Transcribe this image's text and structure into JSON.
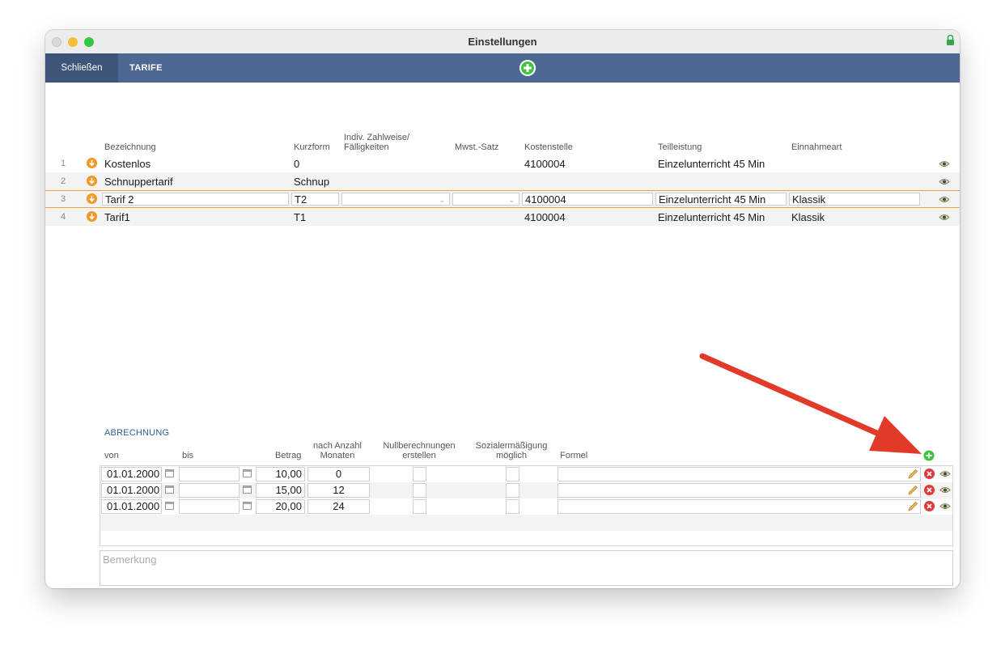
{
  "window": {
    "title": "Einstellungen"
  },
  "toolbar": {
    "close_label": "Schließen",
    "tab_label": "TARIFE"
  },
  "table": {
    "headers": {
      "bezeichnung": "Bezeichnung",
      "kurzform": "Kurzform",
      "zahlweise_1": "Indiv. Zahlweise/",
      "zahlweise_2": "Fälligkeiten",
      "mwst": "Mwst.-Satz",
      "kostenstelle": "Kostenstelle",
      "teilleistung": "Teilleistung",
      "einnahmeart": "Einnahmeart"
    },
    "rows": [
      {
        "num": "1",
        "bezeichnung": "Kostenlos",
        "kurzform": "0",
        "kostenstelle": "4100004",
        "teilleistung": "Einzelunterricht 45 Min",
        "einnahmeart": ""
      },
      {
        "num": "2",
        "bezeichnung": "Schnuppertarif",
        "kurzform": "Schnup",
        "kostenstelle": "",
        "teilleistung": "",
        "einnahmeart": ""
      },
      {
        "num": "3",
        "bezeichnung": "Tarif 2",
        "kurzform": "T2",
        "kostenstelle": "4100004",
        "teilleistung": "Einzelunterricht 45 Min",
        "einnahmeart": "Klassik",
        "selected": true
      },
      {
        "num": "4",
        "bezeichnung": "Tarif1",
        "kurzform": "T1",
        "kostenstelle": "4100004",
        "teilleistung": "Einzelunterricht 45 Min",
        "einnahmeart": "Klassik"
      }
    ]
  },
  "abrechnung": {
    "title": "ABRECHNUNG",
    "headers": {
      "von": "von",
      "bis": "bis",
      "betrag": "Betrag",
      "anzahl_1": "nach Anzahl",
      "anzahl_2": "Monaten",
      "null_1": "Nullberechnungen",
      "null_2": "erstellen",
      "sozial_1": "Sozialermäßigung",
      "sozial_2": "möglich",
      "formel": "Formel"
    },
    "rows": [
      {
        "von": "01.01.2000",
        "bis": "",
        "betrag": "10,00",
        "monate": "0",
        "formel": ""
      },
      {
        "von": "01.01.2000",
        "bis": "",
        "betrag": "15,00",
        "monate": "12",
        "formel": ""
      },
      {
        "von": "01.01.2000",
        "bis": "",
        "betrag": "20,00",
        "monate": "24",
        "formel": ""
      }
    ],
    "remark_placeholder": "Bemerkung"
  },
  "colors": {
    "toolbar": "#4e6894",
    "accent_orange": "#f09a2a",
    "add_green": "#3cc43c",
    "delete_red": "#e03a3a",
    "arrow_red": "#e23a28"
  }
}
